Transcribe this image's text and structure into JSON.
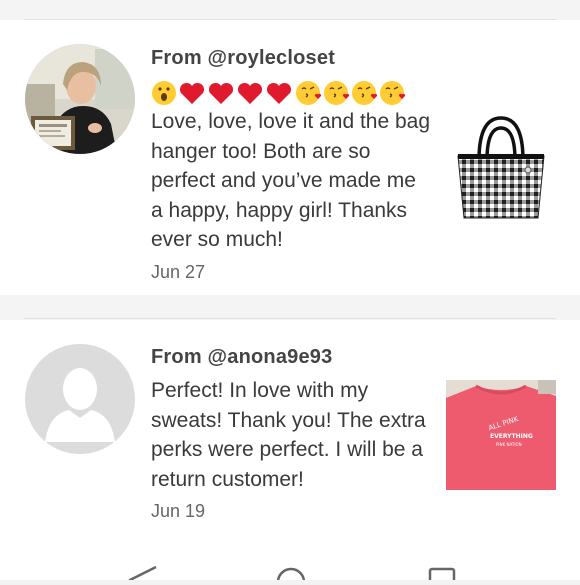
{
  "reviews": [
    {
      "from": "From @roylecloset",
      "emojis": "😮❤️❤️❤️❤️😘😘😘😘",
      "text": "Love, love, love it and the bag hanger too! Both are so perfect and you’ve made me a happy, happy girl! Thanks ever so much!",
      "date": "Jun 27",
      "avatar_icon": "profile-photo",
      "thumbnail_icon": "gingham-tote-bag"
    },
    {
      "from": "From @anona9e93",
      "text": "Perfect! In love with my sweats! Thank you! The extra perks were perfect. I will be a return customer!",
      "date": "Jun 19",
      "avatar_icon": "default-user-icon",
      "thumbnail_icon": "pink-sweatshirt",
      "thumbnail_print": {
        "line1": "ALL PINK",
        "line2": "EVERYTHING",
        "line3": "PINK NATION"
      }
    }
  ],
  "navbar": {
    "back_icon": "back-triangle-icon",
    "home_icon": "home-circle-icon",
    "recents_icon": "recents-square-icon"
  },
  "colors": {
    "background": "#f4f4f4",
    "card": "#ffffff",
    "text": "#3a3a3a",
    "date": "#666666",
    "heart": "#e0192d",
    "sweatshirt": "#ee5a6e"
  }
}
